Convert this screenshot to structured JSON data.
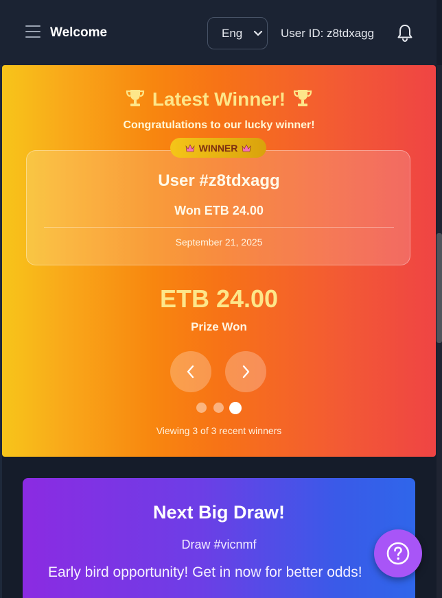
{
  "header": {
    "welcome": "Welcome",
    "language": "Eng",
    "user_id": "User ID: z8tdxagg"
  },
  "banner": {
    "title": "Latest Winner!",
    "subtitle": "Congratulations to our lucky winner!",
    "badge": "WINNER",
    "card": {
      "user": "User #z8tdxagg",
      "won": "Won ETB 24.00",
      "date": "September 21, 2025"
    },
    "prize_amount": "ETB 24.00",
    "prize_label": "Prize Won",
    "carousel": {
      "current": 3,
      "total": 3
    },
    "viewing": "Viewing 3 of 3 recent winners"
  },
  "draw": {
    "title": "Next Big Draw!",
    "draw_id": "Draw #vicnmf",
    "message": "Early bird opportunity! Get in now for better odds!"
  },
  "colors": {
    "accent_gold": "#fde68a",
    "help_button": "#a855f7",
    "header_bg": "#1b2333"
  },
  "icons": [
    "menu-icon",
    "chevron-down-icon",
    "bell-icon",
    "trophy-icon",
    "crown-icon",
    "chevron-left-icon",
    "chevron-right-icon",
    "help-icon"
  ]
}
